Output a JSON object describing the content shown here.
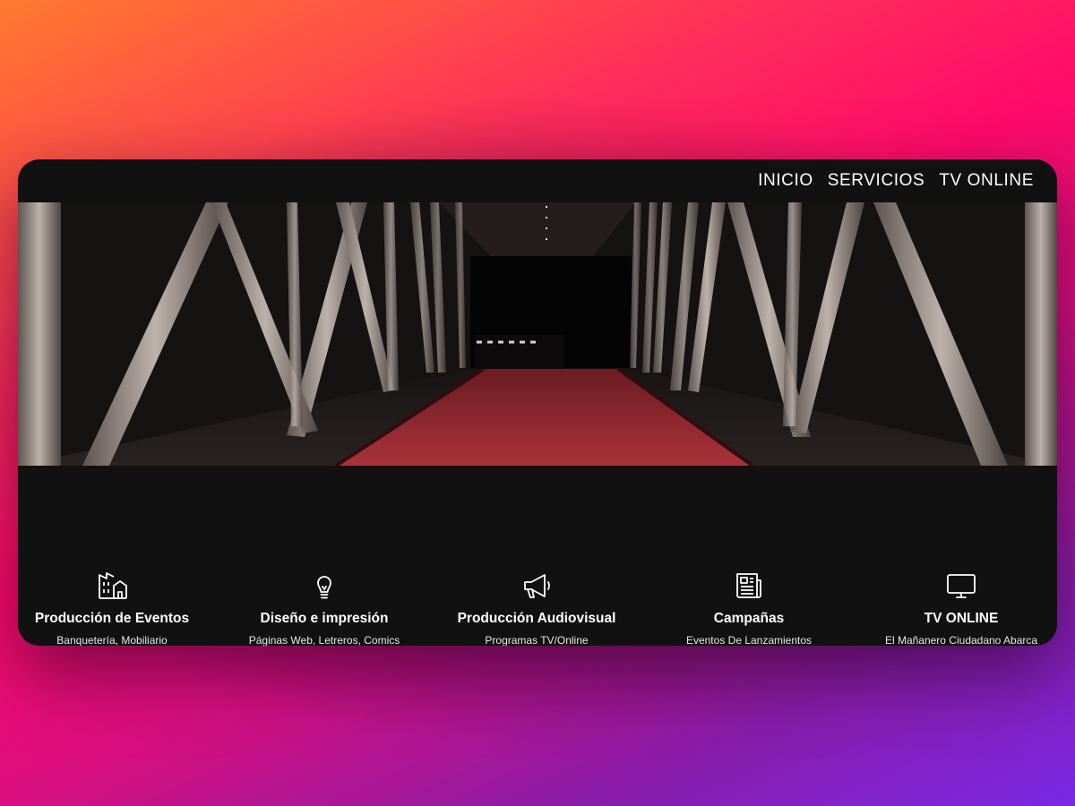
{
  "nav": {
    "items": [
      "INICIO",
      "SERVICIOS",
      "TV ONLINE"
    ]
  },
  "hero": {
    "image": "red-carpet-corridor-photo"
  },
  "services": [
    {
      "icon": "building-icon",
      "title": "Producción de Eventos",
      "desc": "Banquetería, Mobiliario"
    },
    {
      "icon": "lightbulb-icon",
      "title": "Diseño e impresión",
      "desc": "Páginas Web, Letreros, Comics"
    },
    {
      "icon": "megaphone-icon",
      "title": "Producción Audiovisual",
      "desc": "Programas TV/Online"
    },
    {
      "icon": "newspaper-icon",
      "title": "Campañas",
      "desc": "Eventos De Lanzamientos"
    },
    {
      "icon": "tv-icon",
      "title": "TV ONLINE",
      "desc": "El Mañanero Ciudadano Abarca"
    }
  ],
  "colors": {
    "page_bg": "#111111",
    "carpet": "#b3303a",
    "text": "#ffffff"
  }
}
